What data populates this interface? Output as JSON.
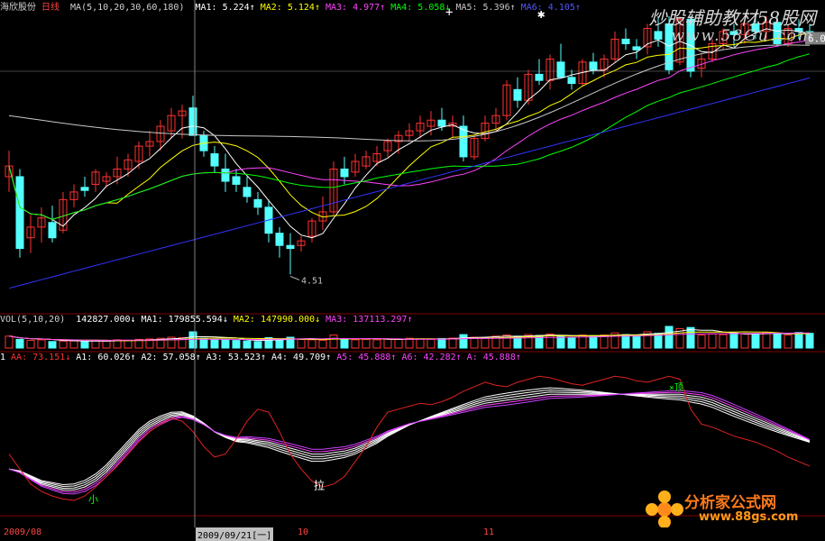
{
  "header": {
    "stock_name": "海欣股份",
    "period": "日线",
    "ma_label": "MA(5,10,20,30,60,180)",
    "ma_values": [
      {
        "text": "MA1: 5.224↑",
        "color": "#ffffff"
      },
      {
        "text": "MA2: 5.124↑",
        "color": "#ffff00"
      },
      {
        "text": "MA3: 4.977↑",
        "color": "#ff44ff"
      },
      {
        "text": "MA4: 5.058↓",
        "color": "#00ff00"
      },
      {
        "text": "MA5: 5.396↑",
        "color": "#c8c8c8"
      },
      {
        "text": "MA6: 4.105↑",
        "color": "#5555ff"
      }
    ]
  },
  "watermark": {
    "brand": "炒股辅助教材58股网",
    "url": "www.58Gu.com"
  },
  "price_labels": {
    "low_marker": "4.51",
    "right_price": "6.0"
  },
  "volume_legend": {
    "label": "VOL(5,10,20)",
    "values": [
      {
        "text": "142827.000↓",
        "color": "#ffffff"
      },
      {
        "text": "MA1: 179855.594↓",
        "color": "#ffffff"
      },
      {
        "text": "MA2: 147990.000↓",
        "color": "#ffff00"
      },
      {
        "text": "MA3: 137113.297↑",
        "color": "#ff44ff"
      }
    ]
  },
  "indicator_legend": {
    "values": [
      {
        "text": "1",
        "color": "#ffffff"
      },
      {
        "text": "AA: 73.151↓",
        "color": "#ff3333"
      },
      {
        "text": "A1: 60.026↑",
        "color": "#ffffff"
      },
      {
        "text": "A2: 57.058↑",
        "color": "#ffffff"
      },
      {
        "text": "A3: 53.523↑",
        "color": "#ffffff"
      },
      {
        "text": "A4: 49.709↑",
        "color": "#ffffff"
      },
      {
        "text": "A5: 45.888↑",
        "color": "#ff44ff"
      },
      {
        "text": "A6: 42.282↑",
        "color": "#ff44ff"
      },
      {
        "text": "A: 45.888↑",
        "color": "#ff44ff"
      }
    ],
    "label_small": "小",
    "label_pull": "拉",
    "label_top": "×顶"
  },
  "logo": {
    "main": "分析家公式网",
    "sub": "www.88gs.com"
  },
  "date_bar": {
    "left": "2009/08",
    "cursor": "2009/09/21[一]",
    "mid": "10",
    "right": "11"
  },
  "colors": {
    "up": "#ff3232",
    "down": "#54ffff",
    "ma1": "#ffffff",
    "ma2": "#ffff00",
    "ma3": "#ff44ff",
    "ma4": "#00ff00",
    "ma5": "#c8c8c8",
    "ma6": "#3333ff",
    "grid": "#800000",
    "indicator_red": "#dd2222"
  },
  "chart_data": {
    "type": "candlestick",
    "price_range": [
      4.3,
      6.2
    ],
    "candles": [
      [
        5.15,
        5.32,
        5.05,
        5.22
      ],
      [
        5.15,
        5.2,
        4.62,
        4.68
      ],
      [
        4.75,
        4.9,
        4.65,
        4.82
      ],
      [
        4.82,
        4.95,
        4.72,
        4.88
      ],
      [
        4.85,
        4.96,
        4.72,
        4.75
      ],
      [
        4.8,
        5.05,
        4.78,
        5.0
      ],
      [
        5.0,
        5.1,
        4.95,
        5.05
      ],
      [
        5.08,
        5.15,
        5.02,
        5.06
      ],
      [
        5.1,
        5.2,
        5.05,
        5.18
      ],
      [
        5.12,
        5.18,
        5.08,
        5.15
      ],
      [
        5.15,
        5.28,
        5.1,
        5.2
      ],
      [
        5.2,
        5.3,
        5.15,
        5.26
      ],
      [
        5.25,
        5.38,
        5.2,
        5.35
      ],
      [
        5.35,
        5.45,
        5.28,
        5.38
      ],
      [
        5.38,
        5.52,
        5.32,
        5.48
      ],
      [
        5.45,
        5.6,
        5.4,
        5.55
      ],
      [
        5.55,
        5.62,
        5.4,
        5.58
      ],
      [
        5.6,
        5.68,
        5.55,
        5.42
      ],
      [
        5.42,
        5.45,
        5.28,
        5.32
      ],
      [
        5.3,
        5.35,
        5.18,
        5.22
      ],
      [
        5.2,
        5.3,
        5.05,
        5.12
      ],
      [
        5.15,
        5.2,
        5.05,
        5.1
      ],
      [
        5.08,
        5.15,
        4.98,
        5.02
      ],
      [
        5.0,
        5.05,
        4.9,
        4.95
      ],
      [
        4.95,
        5.0,
        4.72,
        4.78
      ],
      [
        4.78,
        4.82,
        4.62,
        4.7
      ],
      [
        4.7,
        4.78,
        4.51,
        4.68
      ],
      [
        4.7,
        4.76,
        4.66,
        4.73
      ],
      [
        4.76,
        4.88,
        4.72,
        4.86
      ],
      [
        4.86,
        5.02,
        4.8,
        4.92
      ],
      [
        4.92,
        5.25,
        4.9,
        5.2
      ],
      [
        5.2,
        5.28,
        5.1,
        5.15
      ],
      [
        5.18,
        5.3,
        5.15,
        5.25
      ],
      [
        5.22,
        5.32,
        5.2,
        5.28
      ],
      [
        5.25,
        5.35,
        5.22,
        5.3
      ],
      [
        5.32,
        5.4,
        5.28,
        5.38
      ],
      [
        5.38,
        5.45,
        5.3,
        5.42
      ],
      [
        5.42,
        5.5,
        5.38,
        5.45
      ],
      [
        5.45,
        5.55,
        5.4,
        5.5
      ],
      [
        5.48,
        5.58,
        5.42,
        5.52
      ],
      [
        5.52,
        5.6,
        5.45,
        5.48
      ],
      [
        5.48,
        5.55,
        5.4,
        5.5
      ],
      [
        5.48,
        5.55,
        5.25,
        5.28
      ],
      [
        5.28,
        5.42,
        5.26,
        5.4
      ],
      [
        5.4,
        5.55,
        5.38,
        5.5
      ],
      [
        5.5,
        5.6,
        5.45,
        5.55
      ],
      [
        5.55,
        5.78,
        5.52,
        5.75
      ],
      [
        5.72,
        5.8,
        5.6,
        5.65
      ],
      [
        5.65,
        5.85,
        5.62,
        5.82
      ],
      [
        5.82,
        5.92,
        5.75,
        5.78
      ],
      [
        5.78,
        5.95,
        5.72,
        5.92
      ],
      [
        5.9,
        6.02,
        5.85,
        5.8
      ],
      [
        5.8,
        5.85,
        5.72,
        5.76
      ],
      [
        5.76,
        5.92,
        5.74,
        5.9
      ],
      [
        5.9,
        5.96,
        5.82,
        5.85
      ],
      [
        5.85,
        5.95,
        5.8,
        5.92
      ],
      [
        5.92,
        6.1,
        5.9,
        6.05
      ],
      [
        6.05,
        6.12,
        5.98,
        6.02
      ],
      [
        6.0,
        6.05,
        5.92,
        5.98
      ],
      [
        6.0,
        6.15,
        5.95,
        6.12
      ],
      [
        6.1,
        6.2,
        6.0,
        6.05
      ],
      [
        6.15,
        6.2,
        5.82,
        5.85
      ],
      [
        5.9,
        6.2,
        5.88,
        6.18
      ],
      [
        6.18,
        6.2,
        5.8,
        5.84
      ],
      [
        5.86,
        5.95,
        5.8,
        5.92
      ],
      [
        5.92,
        6.05,
        5.9,
        6.02
      ],
      [
        6.02,
        6.12,
        5.98,
        6.1
      ],
      [
        6.1,
        6.15,
        6.0,
        6.08
      ],
      [
        6.08,
        6.18,
        6.02,
        6.15
      ],
      [
        6.15,
        6.2,
        6.05,
        6.1
      ],
      [
        6.1,
        6.2,
        6.05,
        6.16
      ],
      [
        6.16,
        6.2,
        6.0,
        6.02
      ],
      [
        6.02,
        6.15,
        6.0,
        6.12
      ],
      [
        6.12,
        6.18,
        6.05,
        6.1
      ],
      [
        6.1,
        6.15,
        6.02,
        6.04
      ]
    ],
    "volume": [
      0.55,
      0.4,
      0.35,
      0.38,
      0.3,
      0.32,
      0.33,
      0.3,
      0.35,
      0.32,
      0.38,
      0.36,
      0.4,
      0.42,
      0.45,
      0.5,
      0.48,
      0.75,
      0.45,
      0.4,
      0.38,
      0.35,
      0.33,
      0.3,
      0.48,
      0.42,
      0.5,
      0.4,
      0.38,
      0.36,
      0.6,
      0.42,
      0.38,
      0.4,
      0.38,
      0.42,
      0.4,
      0.45,
      0.42,
      0.4,
      0.44,
      0.46,
      0.62,
      0.5,
      0.48,
      0.55,
      0.6,
      0.55,
      0.62,
      0.58,
      0.65,
      0.55,
      0.5,
      0.6,
      0.55,
      0.6,
      0.7,
      0.62,
      0.58,
      0.75,
      0.68,
      1.0,
      0.9,
      0.95,
      0.6,
      0.65,
      0.62,
      0.7,
      0.66,
      0.62,
      0.72,
      0.68,
      0.6,
      0.72,
      0.68
    ],
    "indicator": {
      "range": [
        0,
        100
      ],
      "AA": [
        40,
        30,
        20,
        15,
        12,
        10,
        9,
        12,
        18,
        25,
        32,
        40,
        48,
        55,
        60,
        64,
        62,
        55,
        45,
        38,
        40,
        50,
        62,
        70,
        68,
        55,
        40,
        30,
        22,
        18,
        20,
        25,
        35,
        45,
        58,
        68,
        70,
        72,
        74,
        73,
        75,
        78,
        82,
        85,
        88,
        86,
        85,
        88,
        90,
        92,
        91,
        89,
        87,
        86,
        88,
        90,
        92,
        91,
        89,
        88,
        90,
        92,
        90,
        70,
        60,
        58,
        55,
        52,
        50,
        48,
        45,
        42,
        38,
        35,
        32
      ],
      "A_base": [
        30,
        28,
        24,
        20,
        18,
        16,
        16,
        18,
        22,
        28,
        36,
        44,
        52,
        58,
        62,
        65,
        66,
        64,
        60,
        55,
        52,
        50,
        50,
        49,
        48,
        46,
        44,
        42,
        40,
        40,
        41,
        42,
        44,
        47,
        50,
        54,
        57,
        60,
        62,
        64,
        66,
        68,
        70,
        72,
        74,
        75,
        76,
        77,
        78,
        79,
        80,
        80,
        80,
        80,
        80,
        80,
        80,
        80,
        80,
        80,
        80,
        80,
        80,
        79,
        78,
        76,
        73,
        70,
        67,
        64,
        61,
        58,
        55,
        52,
        49
      ]
    },
    "cursor_index": 27
  }
}
